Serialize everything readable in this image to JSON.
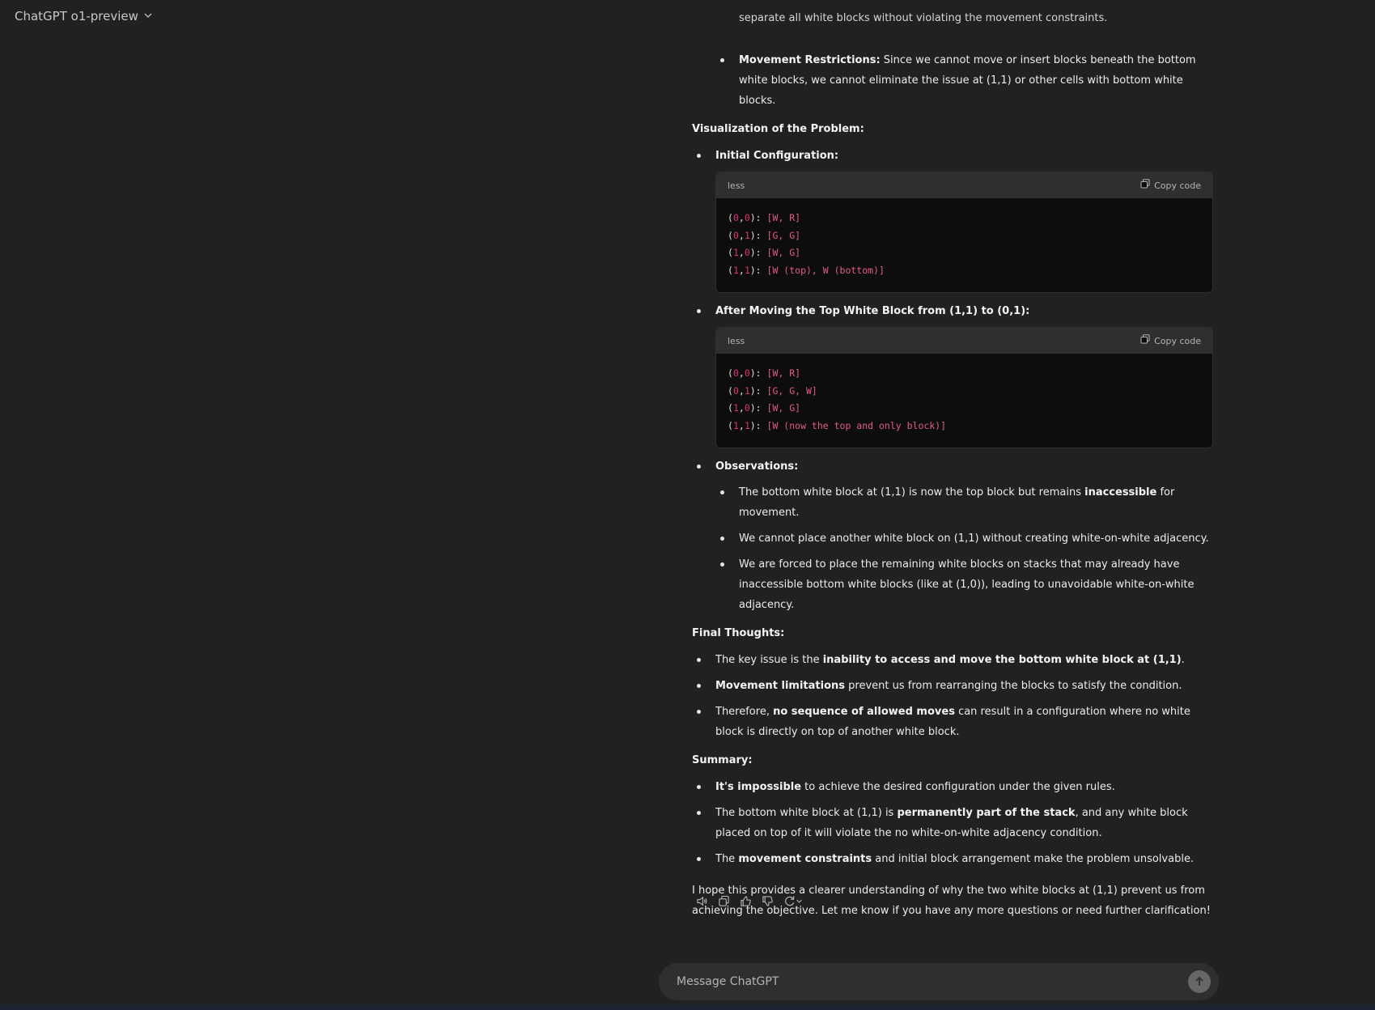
{
  "header": {
    "model_label": "ChatGPT o1-preview"
  },
  "message": {
    "clipped_top_line": "separate all white blocks without violating the movement constraints.",
    "movement_restrictions": {
      "label": "Movement Restrictions:",
      "text": " Since we cannot move or insert blocks beneath the bottom white blocks, we cannot eliminate the issue at (1,1) or other cells with bottom white blocks."
    },
    "visualization_heading": "Visualization of the Problem:",
    "initial_config_label": "Initial Configuration:",
    "code1": {
      "lang": "less",
      "copy_label": "Copy code",
      "lines": [
        {
          "a": "(",
          "n1": "0",
          "c": ",",
          "n2": "0",
          "b": "): ",
          "s": "[W, R]"
        },
        {
          "a": "(",
          "n1": "0",
          "c": ",",
          "n2": "1",
          "b": "): ",
          "s": "[G, G]"
        },
        {
          "a": "(",
          "n1": "1",
          "c": ",",
          "n2": "0",
          "b": "): ",
          "s": "[W, G]"
        },
        {
          "a": "(",
          "n1": "1",
          "c": ",",
          "n2": "1",
          "b": "): ",
          "s": "[W (top), W (bottom)]"
        }
      ]
    },
    "after_moving_label": "After Moving the Top White Block from (1,1) to (0,1):",
    "code2": {
      "lang": "less",
      "copy_label": "Copy code",
      "lines": [
        {
          "a": "(",
          "n1": "0",
          "c": ",",
          "n2": "0",
          "b": "): ",
          "s": "[W, R]"
        },
        {
          "a": "(",
          "n1": "0",
          "c": ",",
          "n2": "1",
          "b": "): ",
          "s": "[G, G, W]"
        },
        {
          "a": "(",
          "n1": "1",
          "c": ",",
          "n2": "0",
          "b": "): ",
          "s": "[W, G]"
        },
        {
          "a": "(",
          "n1": "1",
          "c": ",",
          "n2": "1",
          "b": "): ",
          "s": "[W (now the top and only block)]"
        }
      ]
    },
    "observations_label": "Observations:",
    "obs1": {
      "pre": "The bottom white block at (1,1) is now the top block but remains ",
      "bold": "inaccessible",
      "post": " for movement."
    },
    "obs2": "We cannot place another white block on (1,1) without creating white-on-white adjacency.",
    "obs3": "We are forced to place the remaining white blocks on stacks that may already have inaccessible bottom white blocks (like at (1,0)), leading to unavoidable white-on-white adjacency.",
    "final_heading": "Final Thoughts:",
    "final1": {
      "pre": "The key issue is the ",
      "bold": "inability to access and move the bottom white block at (1,1)",
      "post": "."
    },
    "final2": {
      "bold": "Movement limitations",
      "post": " prevent us from rearranging the blocks to satisfy the condition."
    },
    "final3": {
      "pre": "Therefore, ",
      "bold": "no sequence of allowed moves",
      "post": " can result in a configuration where no white block is directly on top of another white block."
    },
    "summary_heading": "Summary:",
    "sum1": {
      "bold": "It's impossible",
      "post": " to achieve the desired configuration under the given rules."
    },
    "sum2": {
      "pre": "The bottom white block at (1,1) is ",
      "bold": "permanently part of the stack",
      "post": ", and any white block placed on top of it will violate the no white-on-white adjacency condition."
    },
    "sum3": {
      "pre": "The ",
      "bold": "movement constraints",
      "post": " and initial block arrangement make the problem unsolvable."
    },
    "closing": "I hope this provides a clearer understanding of why the two white blocks at (1,1) prevent us from achieving the objective. Let me know if you have any more questions or need further clarification!"
  },
  "composer": {
    "placeholder": "Message ChatGPT"
  },
  "icons": [
    "chevron-down-icon",
    "copy-icon",
    "speaker-icon",
    "thumbs-up-icon",
    "thumbs-down-icon",
    "regenerate-icon",
    "arrow-up-icon"
  ]
}
